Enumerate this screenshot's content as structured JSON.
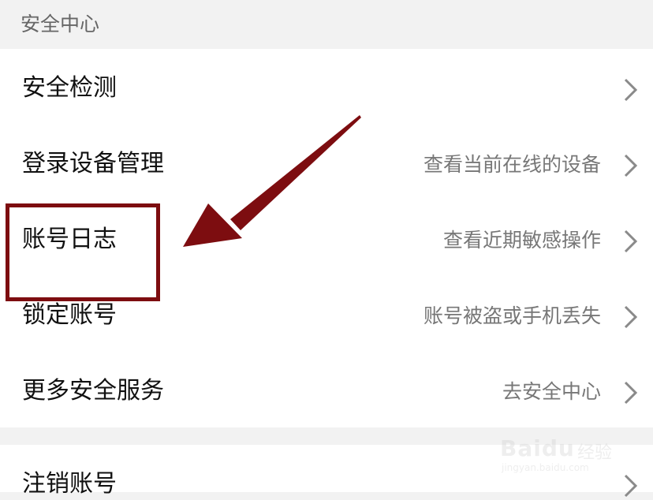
{
  "section": {
    "title": "安全中心"
  },
  "rows": [
    {
      "label": "安全检测",
      "hint": ""
    },
    {
      "label": "登录设备管理",
      "hint": "查看当前在线的设备"
    },
    {
      "label": "账号日志",
      "hint": "查看近期敏感操作"
    },
    {
      "label": "锁定账号",
      "hint": "账号被盗或手机丢失"
    },
    {
      "label": "更多安全服务",
      "hint": "去安全中心"
    }
  ],
  "secondary_rows": [
    {
      "label": "注销账号"
    }
  ],
  "icons": {
    "chevron": "chevron-right-icon"
  },
  "watermark": {
    "brand": "Baidu",
    "brand_cn": "经验",
    "url": "jingyan.baidu.com"
  },
  "colors": {
    "annotation": "#7d0d10",
    "background": "#f2f2f2",
    "card": "#ffffff"
  }
}
